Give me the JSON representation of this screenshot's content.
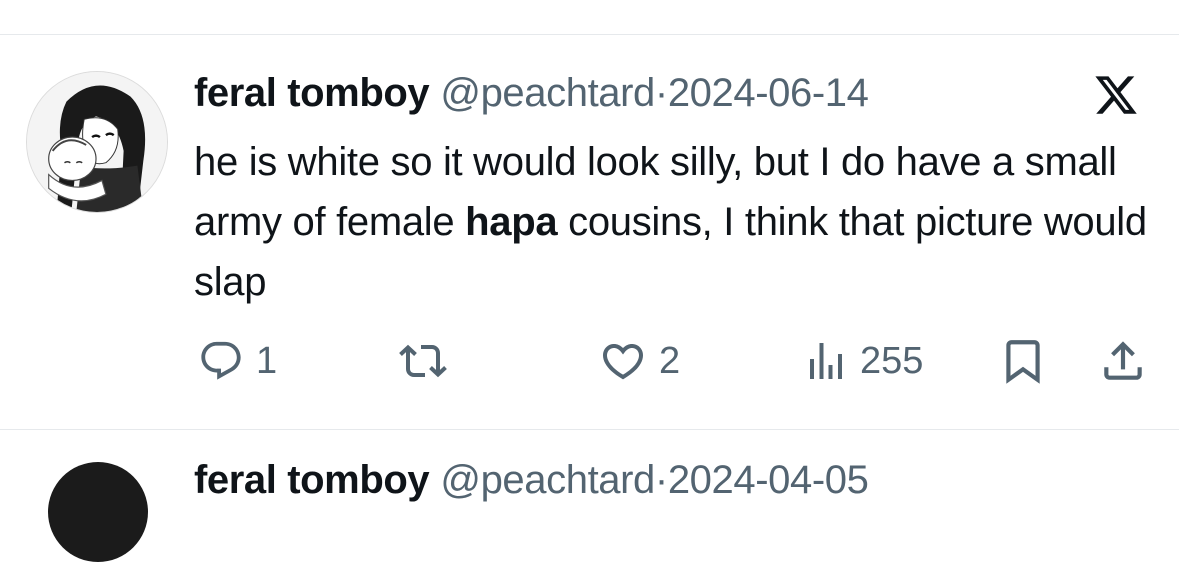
{
  "tweet": {
    "display_name": "feral tomboy",
    "handle": "@peachtard",
    "separator": "·",
    "date": "2024-06-14",
    "text_part1": "he is white so it would look silly, but I do have a small army of female ",
    "text_emphasis": "hapa",
    "text_part2": " cousins, I think that picture would slap",
    "actions": {
      "reply_count": "1",
      "like_count": "2",
      "views_count": "255"
    }
  },
  "next_tweet": {
    "display_name": "feral tomboy",
    "handle": "@peachtard",
    "separator": "·",
    "date": "2024-04-05"
  },
  "colors": {
    "text_primary": "#0f1419",
    "text_secondary": "#536471",
    "divider": "#e6e9ec"
  },
  "icons": [
    "avatar",
    "x-logo-icon",
    "reply-icon",
    "retweet-icon",
    "like-icon",
    "views-icon",
    "bookmark-icon",
    "share-icon"
  ]
}
